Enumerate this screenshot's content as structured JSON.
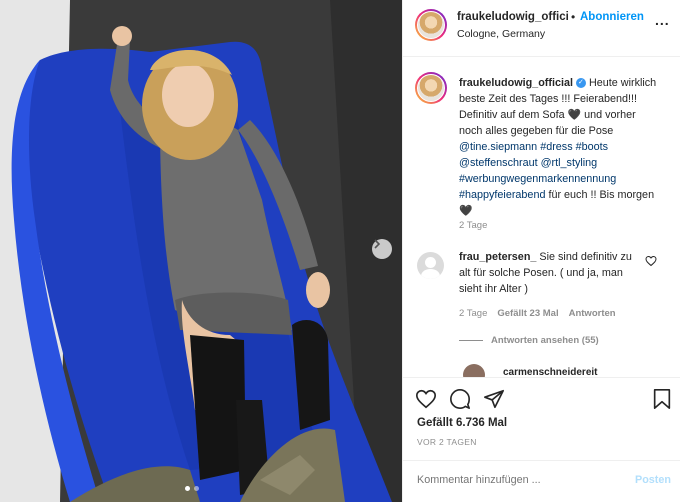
{
  "header": {
    "username": "fraukeludowig_offici",
    "separator": "•",
    "follow_label": "Abonnieren",
    "location": "Cologne, Germany",
    "more_label": "..."
  },
  "caption": {
    "username": "fraukeludowig_official",
    "verified_mark": "✓",
    "line1": "Heute wirklich beste Zeit des Tages !!! Feierabend!!! Definitiv auf dem Sofa",
    "line2": "und vorher noch alles gegeben für die Pose",
    "tag1": "@tine.siepmann",
    "tag2": "#dress",
    "tag3": "#boots",
    "tag4": "@steffenschraut",
    "tag5": "@rtl_styling",
    "tag6": "#werbungwegenmarkennennung",
    "tag7": "#happyfeierabend",
    "line3": "für euch !! Bis morgen",
    "heart": "🖤",
    "time": "2 Tage"
  },
  "comment": {
    "username": "frau_petersen_",
    "text": "Sie sind definitiv zu alt für solche Posen. ( und ja, man sieht ihr Alter )",
    "time": "2 Tage",
    "likes": "Gefällt 23 Mal",
    "reply": "Antworten",
    "view_replies": "Antworten ansehen (55)"
  },
  "next_comment_user": "carmenschneidereit",
  "actions": {
    "likes": "Gefällt 6.736 Mal",
    "date": "VOR 2 TAGEN",
    "comment_placeholder": "Kommentar hinzufügen ...",
    "post_label": "Posten"
  },
  "carousel": {
    "current": 1,
    "total": 2
  },
  "colors": {
    "accent": "#0095f6",
    "link": "#00376b",
    "sofa": "#1f3fc0",
    "muted": "#8e8e8e"
  }
}
